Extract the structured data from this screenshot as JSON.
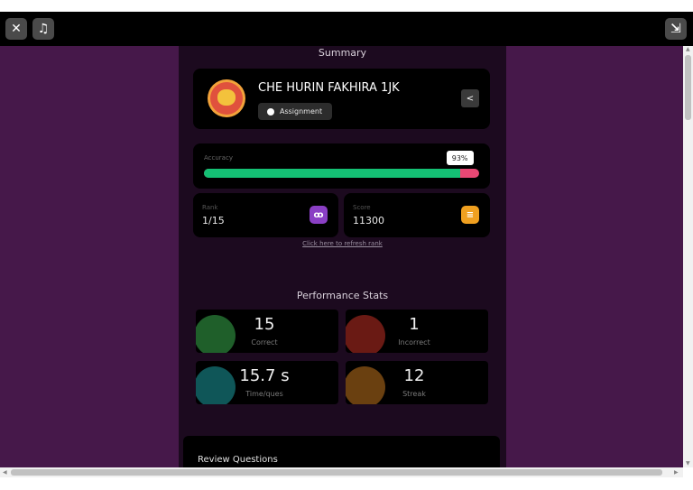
{
  "topbar": {
    "close_glyph": "✕",
    "music_glyph": "♫",
    "minimize_glyph": "⇲"
  },
  "summary": {
    "title": "Summary",
    "player_name": "CHE HURIN FAKHIRA 1JK",
    "mode_tag": "Assignment",
    "share_glyph": "<"
  },
  "accuracy": {
    "label": "Accuracy",
    "value_text": "93%",
    "fraction": 0.93,
    "correct_color": "#14c074",
    "incorrect_color": "#e84874"
  },
  "rank": {
    "label": "Rank",
    "value": "1/15",
    "badge_color": "#8a3fc4"
  },
  "score": {
    "label": "Score",
    "value": "11300",
    "badge_color": "#f0a020"
  },
  "refresh_link": "Click here to refresh rank",
  "performance": {
    "title": "Performance Stats",
    "stats": [
      {
        "value": "15",
        "label": "Correct",
        "icon": "check-icon",
        "color": "#1f5f2a"
      },
      {
        "value": "1",
        "label": "Incorrect",
        "icon": "cross-icon",
        "color": "#6a1a14"
      },
      {
        "value": "15.7 s",
        "label": "Time/ques",
        "icon": "timer-icon",
        "color": "#0f5658"
      },
      {
        "value": "12",
        "label": "Streak",
        "icon": "fire-icon",
        "color": "#6a4010"
      }
    ]
  },
  "review": {
    "title": "Review Questions"
  }
}
